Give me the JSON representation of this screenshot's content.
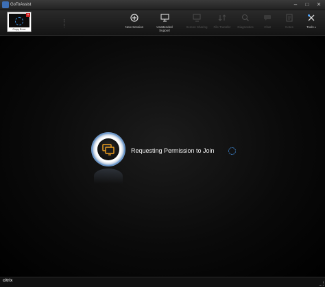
{
  "window": {
    "title": "GoToAssist",
    "icon": "gotoassist-logo-icon",
    "controls": [
      "minimize",
      "maximize",
      "close"
    ],
    "control_glyphs": {
      "minimize": "–",
      "maximize": "□",
      "close": "✕"
    }
  },
  "session_tab": {
    "label": "Copy Error",
    "close_glyph": "×"
  },
  "toolbar": {
    "items": [
      {
        "label": "New Session",
        "icon": "plus-circle-icon",
        "enabled": true
      },
      {
        "label": "Unattended Support",
        "icon": "monitor-icon",
        "enabled": true
      },
      {
        "label": "Screen Sharing",
        "icon": "screen-share-icon",
        "enabled": false
      },
      {
        "label": "File Transfer",
        "icon": "file-transfer-icon",
        "enabled": false
      },
      {
        "label": "Diagnostics",
        "icon": "diagnostics-icon",
        "enabled": false
      },
      {
        "label": "Chat",
        "icon": "chat-icon",
        "enabled": false
      },
      {
        "label": "Notes",
        "icon": "notes-icon",
        "enabled": false
      },
      {
        "label": "Tools",
        "icon": "tools-icon",
        "enabled": true
      }
    ]
  },
  "main": {
    "status_text": "Requesting Permission to Join",
    "status_icon": "remote-desktop-icon"
  },
  "statusbar": {
    "brand": "citrix"
  },
  "colors": {
    "accent": "#4aa3ff",
    "icon_orange": "#f0a020",
    "background": "#000000"
  }
}
